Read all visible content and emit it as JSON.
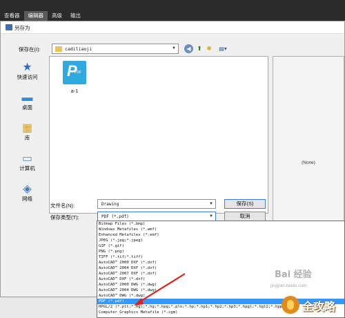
{
  "app_menu": {
    "tabs": [
      "查看器",
      "编辑器",
      "高级",
      "输出"
    ],
    "active": "编辑器"
  },
  "dialog": {
    "title": "另存为",
    "lookin_label": "保存在(I):",
    "lookin_value": "cadiliaoji",
    "toolbar": {
      "back_icon": "back-icon",
      "up_icon": "up-folder-icon",
      "new_folder_icon": "new-folder-icon",
      "views_icon": "views-menu-icon"
    },
    "places": [
      {
        "label": "快速访问",
        "icon": "star-icon",
        "glyph": "★",
        "color": "#2a6fd4"
      },
      {
        "label": "桌面",
        "icon": "desktop-icon",
        "glyph": "▬",
        "color": "#2a8de0"
      },
      {
        "label": "库",
        "icon": "library-icon",
        "glyph": "▦",
        "color": "#d9a43a"
      },
      {
        "label": "计算机",
        "icon": "computer-icon",
        "glyph": "▭",
        "color": "#5a8fc8"
      },
      {
        "label": "网络",
        "icon": "network-icon",
        "glyph": "◈",
        "color": "#3a78c8"
      }
    ],
    "files": [
      {
        "name": "a-1",
        "badge": "PDF",
        "icon": "pdf-file-icon"
      }
    ],
    "preview_text": "(None)",
    "filename_label": "文件名(N):",
    "filename_value": "Drawing",
    "filetype_label": "保存类型(T):",
    "filetype_value": "PDF (*.pdf)",
    "save_button": "保存(S)",
    "cancel_button": "取消",
    "filetype_options": [
      "Bitmap Files (*.bmp)",
      "Windows Metafiles (*.wmf)",
      "Enhanced Metafiles (*.emf)",
      "JPEG (*.jpg;*.jpeg)",
      "GIF (*.gif)",
      "PNG (*.png)",
      "TIFF (*.tif;*.tiff)",
      "AutoCAD™ 2000 DXF (*.dxf)",
      "AutoCAD™ 2004 DXF (*.dxf)",
      "AutoCAD™ 2007 DXF (*.dxf)",
      "AutoCAD™ DXF (*.dxf)",
      "AutoCAD™ 2000 DWG (*.dwg)",
      "AutoCAD™ 2004 DWG (*.dwg)",
      "AutoCAD™ DWG (*.dwg)",
      "PDF (*.pdf)",
      "HPGL/2 (*.plt;*.hgl;*.hg;*.hpg;*.plo;*.hp;*.hp1;*.hp2;*.hp3;*.hpgl;*.hgl2;*.hpp)",
      "Computer Graphics Metafile (*.cgm)"
    ],
    "selected_option": "PDF (*.pdf)"
  },
  "watermark": {
    "text": "Bai 经验",
    "url": "jingyan.baidu.com",
    "logo_text": "全攻略"
  }
}
